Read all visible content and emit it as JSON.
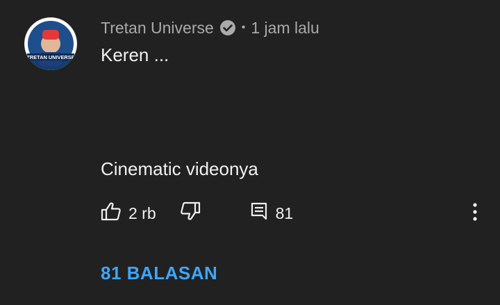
{
  "comment": {
    "author": "Tretan Universe",
    "time": "1 jam lalu",
    "separator": "•",
    "text_line1": "Keren ...",
    "text_line2": "Cinematic videonya",
    "avatar_text": "TRETAN UNIVERSE",
    "verified": true
  },
  "actions": {
    "like_count": "2 rb",
    "reply_count": "81"
  },
  "replies_link": "81 BALASAN",
  "icons": {
    "like": "thumbs-up-icon",
    "dislike": "thumbs-down-icon",
    "reply": "comment-icon",
    "more": "more-vert-icon",
    "verified": "verified-check-icon"
  },
  "colors": {
    "background": "#212121",
    "text": "#f1f1f1",
    "secondary_text": "#aaaaaa",
    "link": "#3ea6ff"
  }
}
